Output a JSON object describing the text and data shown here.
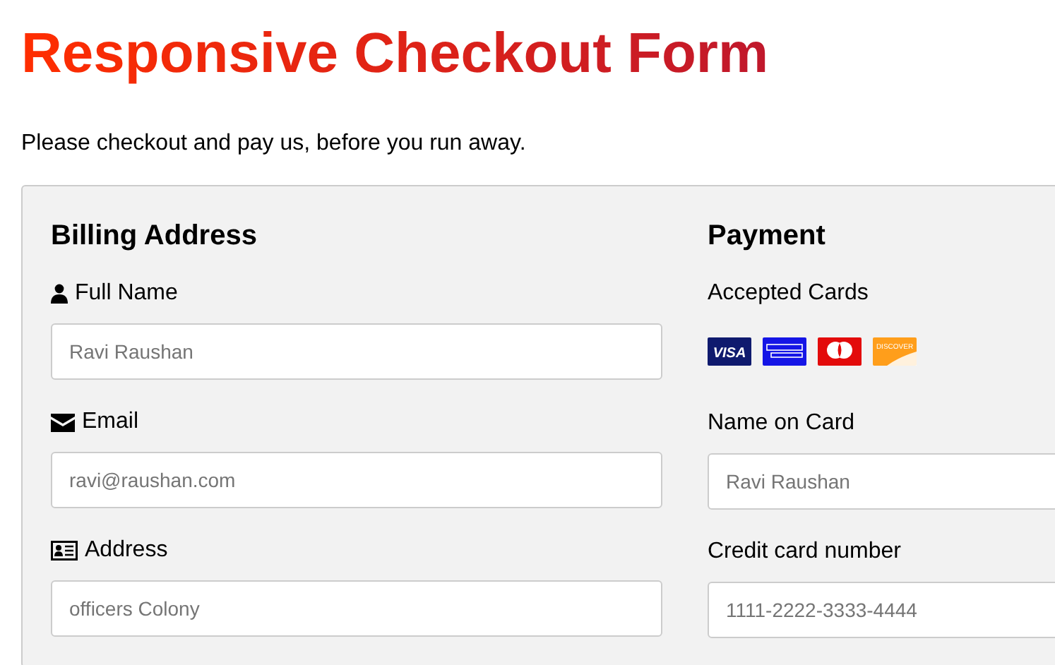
{
  "title": "Responsive Checkout Form",
  "intro": "Please checkout and pay us, before you run away.",
  "billing": {
    "heading": "Billing Address",
    "fields": [
      {
        "kind": "user",
        "label": "Full Name",
        "placeholder": "Ravi Raushan"
      },
      {
        "kind": "envelope",
        "label": "Email",
        "placeholder": "ravi@raushan.com"
      },
      {
        "kind": "card",
        "label": "Address",
        "placeholder": "officers Colony"
      }
    ]
  },
  "payment": {
    "heading": "Payment",
    "cards_label": "Accepted Cards",
    "cards": [
      {
        "kind": "visa",
        "label": "VISA"
      },
      {
        "kind": "amex"
      },
      {
        "kind": "mastercard"
      },
      {
        "kind": "discover",
        "label": "DISCOVER"
      }
    ],
    "fields": [
      {
        "label": "Name on Card",
        "placeholder": "Ravi Raushan"
      },
      {
        "label": "Credit card number",
        "placeholder": "1111-2222-3333-4444"
      }
    ]
  }
}
